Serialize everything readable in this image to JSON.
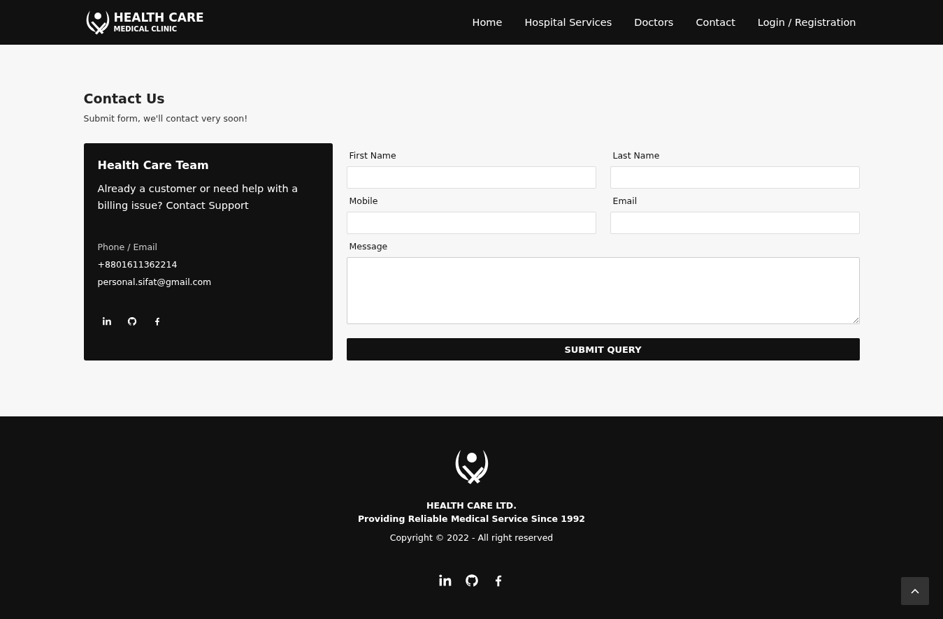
{
  "header": {
    "logo": {
      "title": "HEALTH CARE",
      "subtitle": "MEDICAL CLINIC"
    },
    "nav": [
      {
        "label": "Home"
      },
      {
        "label": "Hospital Services"
      },
      {
        "label": "Doctors"
      },
      {
        "label": "Contact"
      },
      {
        "label": "Login / Registration"
      }
    ]
  },
  "contact": {
    "title": "Contact Us",
    "subtitle": "Submit form, we'll contact very soon!",
    "card": {
      "title": "Health Care Team",
      "text": "Already a customer or need help with a billing issue? Contact Support",
      "info_label": "Phone / Email",
      "phone": "+8801611362214",
      "email": "personal.sifat@gmail.com",
      "socials": [
        {
          "kind": "linkedin"
        },
        {
          "kind": "github"
        },
        {
          "kind": "facebook"
        }
      ]
    },
    "form": {
      "fields": [
        {
          "label": "First Name",
          "kind": "input"
        },
        {
          "label": "Last Name",
          "kind": "input"
        },
        {
          "label": "Mobile",
          "kind": "input"
        },
        {
          "label": "Email",
          "kind": "input"
        },
        {
          "label": "Message",
          "kind": "textarea"
        }
      ],
      "submit": "SUBMIT QUERY"
    }
  },
  "footer": {
    "company": "HEALTH CARE LTD.",
    "tagline": "Providing Reliable Medical Service Since 1992",
    "copyright": "Copyright © 2022 - All right reserved",
    "socials": [
      {
        "kind": "linkedin"
      },
      {
        "kind": "github"
      },
      {
        "kind": "facebook"
      }
    ]
  }
}
